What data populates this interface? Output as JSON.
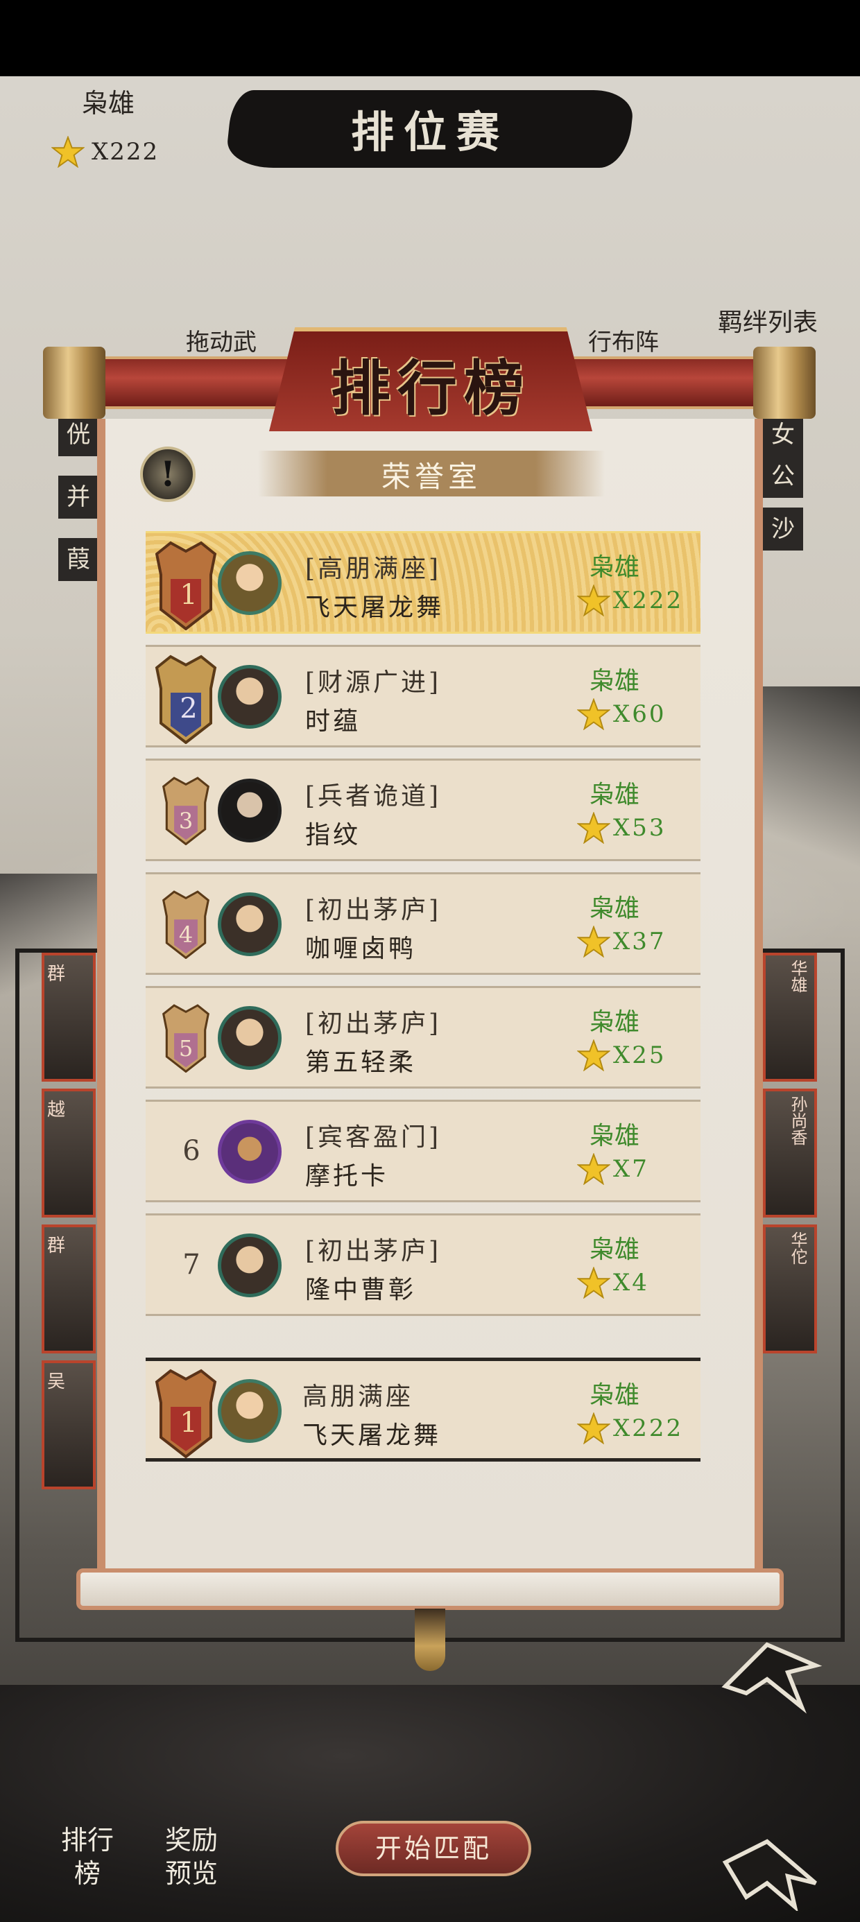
{
  "header": {
    "player_name": "枭雄",
    "star_count": "X222",
    "mode_title": "排位赛",
    "bond_list": "羁绊列表",
    "drag_hint_left": "拖动武",
    "drag_hint_right": "行布阵"
  },
  "side_tags_left": [
    "侊",
    "并",
    "葭"
  ],
  "side_tags_right": [
    "女",
    "公",
    "沙"
  ],
  "hero_cards_left": [
    "群",
    "越",
    "群",
    "吴"
  ],
  "hero_cards_right": [
    "华雄",
    "孙尚香",
    "华佗"
  ],
  "leaderboard": {
    "title": "排行榜",
    "hall_title": "荣誉室",
    "info_icon": "exclamation-icon",
    "rows": [
      {
        "rank": "1",
        "title": "[高朋满座]",
        "name": "飞天屠龙舞",
        "server": "枭雄",
        "stars": "X222"
      },
      {
        "rank": "2",
        "title": "[财源广进]",
        "name": "时蕴",
        "server": "枭雄",
        "stars": "X60"
      },
      {
        "rank": "3",
        "title": "[兵者诡道]",
        "name": "指纹",
        "server": "枭雄",
        "stars": "X53"
      },
      {
        "rank": "4",
        "title": "[初出茅庐]",
        "name": "咖喱卤鸭",
        "server": "枭雄",
        "stars": "X37"
      },
      {
        "rank": "5",
        "title": "[初出茅庐]",
        "name": "第五轻柔",
        "server": "枭雄",
        "stars": "X25"
      },
      {
        "rank": "6",
        "title": "[宾客盈门]",
        "name": "摩托卡",
        "server": "枭雄",
        "stars": "X7"
      },
      {
        "rank": "7",
        "title": "[初出茅庐]",
        "name": "隆中曹彰",
        "server": "枭雄",
        "stars": "X4"
      }
    ],
    "my_row": {
      "rank": "1",
      "title": "高朋满座",
      "name": "飞天屠龙舞",
      "server": "枭雄",
      "stars": "X222"
    }
  },
  "bottom": {
    "rank_button": "排行榜",
    "rank_button_l1": "排行",
    "rank_button_l2": "榜",
    "reward_button_l1": "奖励",
    "reward_button_l2": "预览",
    "match_button": "开始匹配"
  },
  "colors": {
    "accent_red": "#8a2b23",
    "score_green": "#3f8a2c",
    "gold": "#d4a870"
  }
}
